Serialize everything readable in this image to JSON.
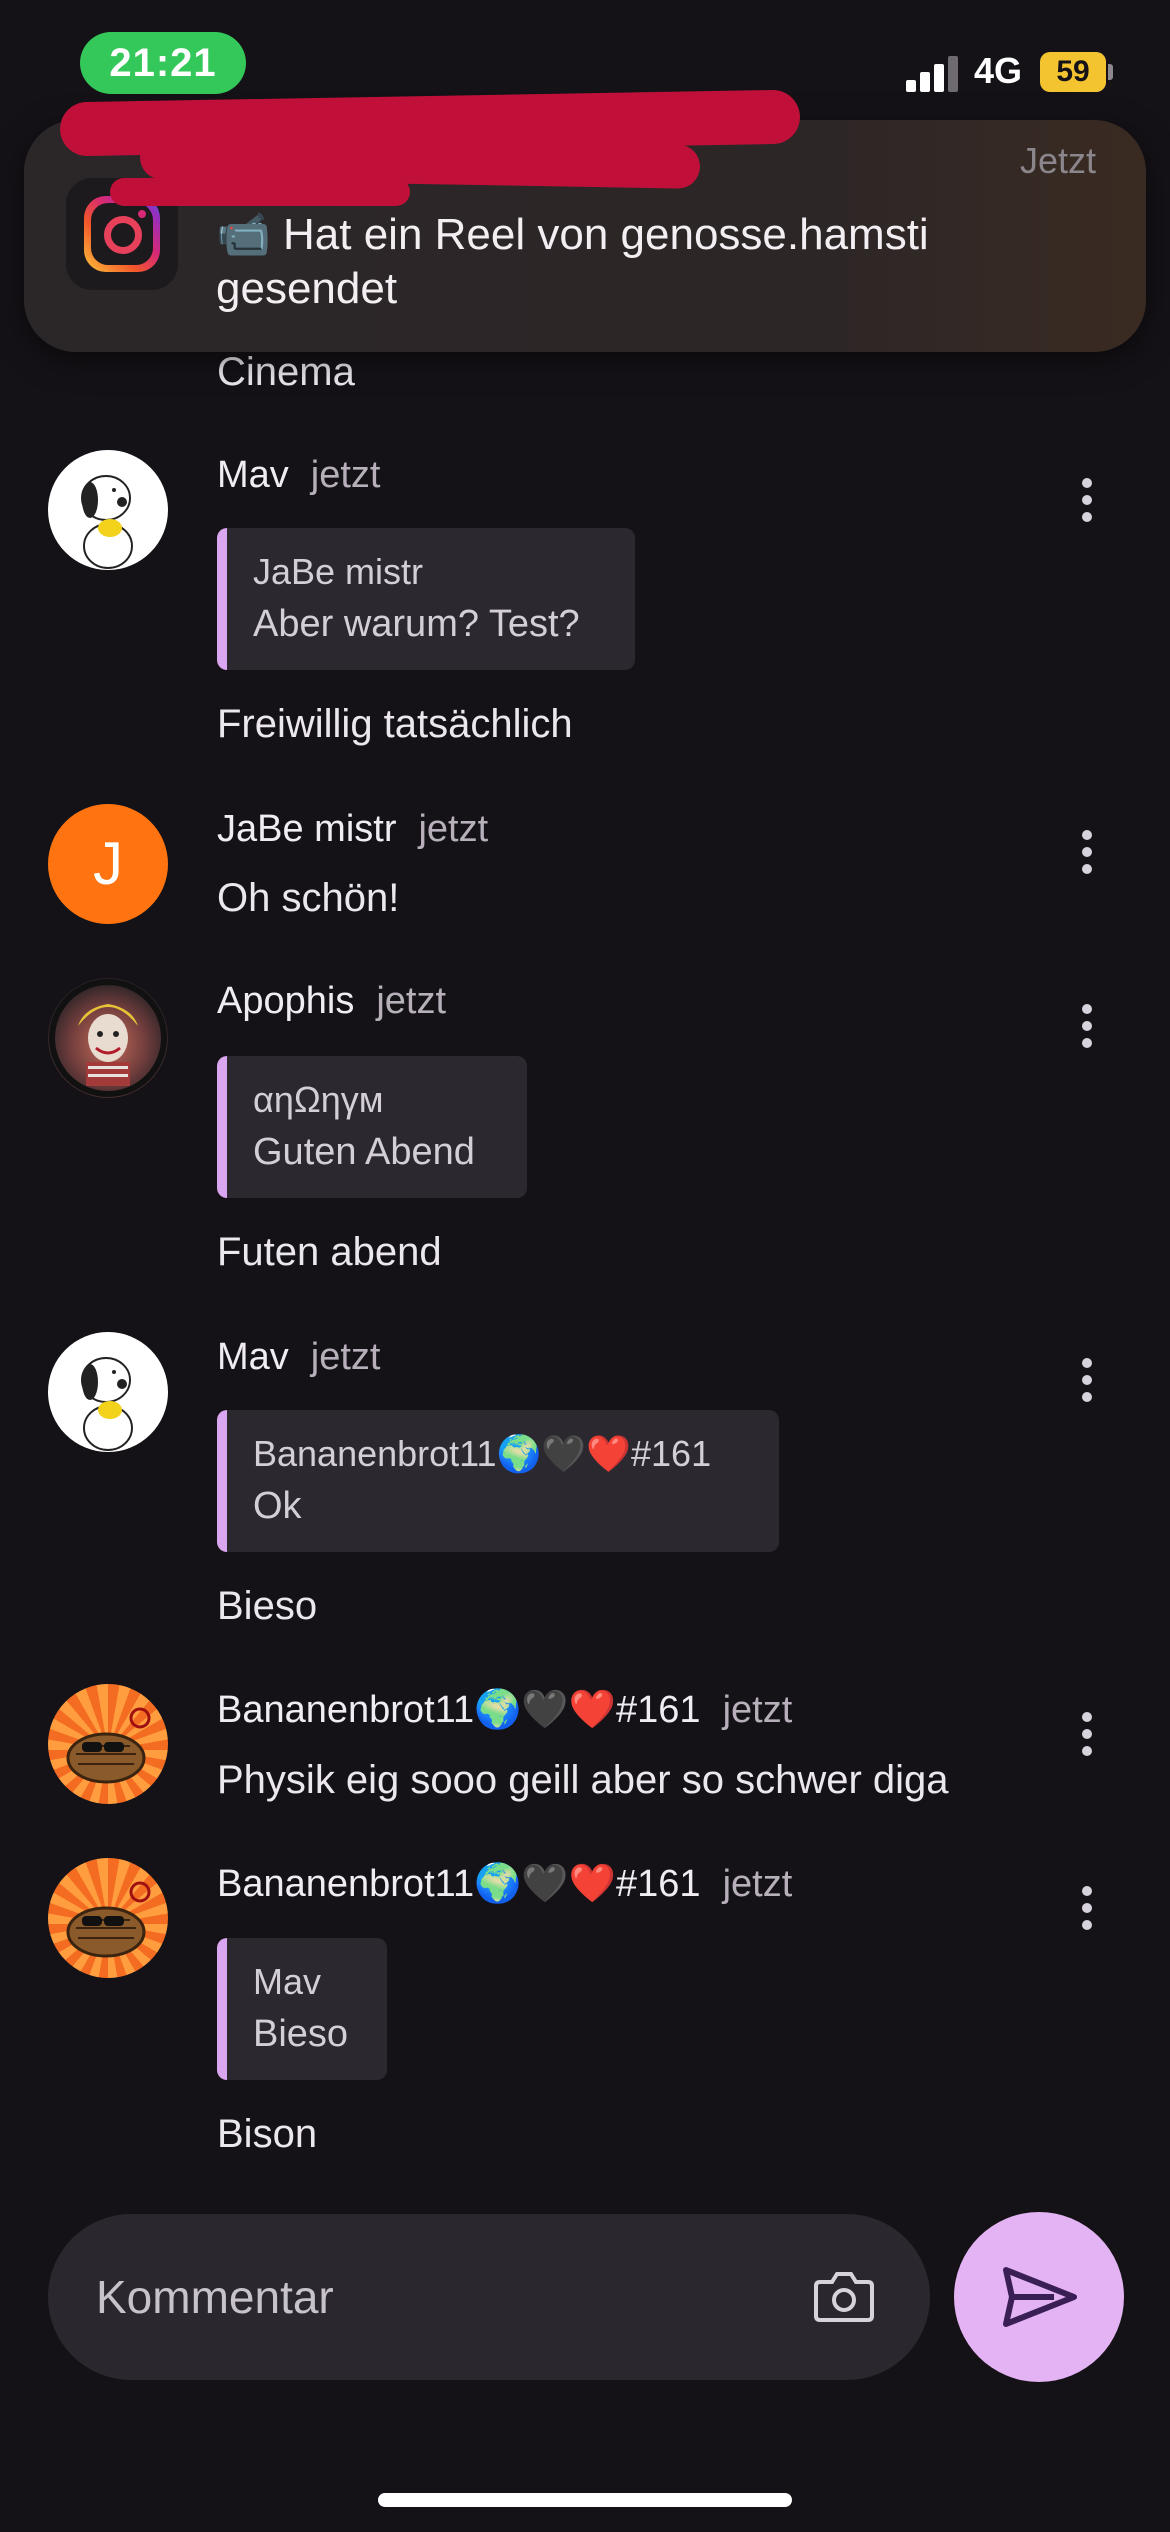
{
  "status_bar": {
    "time": "21:21",
    "network": "4G",
    "battery": "59"
  },
  "notification": {
    "app_icon": "instagram-icon",
    "time": "Jetzt",
    "text": "📹 Hat ein Reel von genosse.hamsti gesendet"
  },
  "partial_message": {
    "text": "Cinema"
  },
  "messages": [
    {
      "author": "Mav",
      "time": "jetzt",
      "avatar": "snoopy-avatar",
      "quote": {
        "author": "JaBe mistr",
        "text": "Aber warum? Test?"
      },
      "text": "Freiwillig tatsächlich"
    },
    {
      "author": "JaBe mistr",
      "time": "jetzt",
      "avatar_letter": "J",
      "text": "Oh schön!"
    },
    {
      "author": "Apophis",
      "time": "jetzt",
      "avatar": "joker-avatar",
      "quote": {
        "author": "αηΩηγм",
        "text": "Guten Abend"
      },
      "text": "Futen abend"
    },
    {
      "author": "Mav",
      "time": "jetzt",
      "avatar": "snoopy-avatar",
      "quote": {
        "author": "Bananenbrot11🌍🖤❤️#161",
        "text": "Ok"
      },
      "text": "Bieso"
    },
    {
      "author": "Bananenbrot11🌍🖤❤️#161",
      "time": "jetzt",
      "avatar": "bug-avatar",
      "text": "Physik eig sooo geill aber so schwer diga"
    },
    {
      "author": "Bananenbrot11🌍🖤❤️#161",
      "time": "jetzt",
      "avatar": "bug-avatar",
      "quote": {
        "author": "Mav",
        "text": "Bieso"
      },
      "text": "Bison"
    }
  ],
  "composer": {
    "placeholder": "Kommentar",
    "camera_icon": "camera-icon",
    "send_icon": "send-icon"
  },
  "colors": {
    "background": "#151217",
    "accent": "#e3b3f4",
    "quote_bar": "#d9a6ef",
    "status_green": "#34c759"
  }
}
